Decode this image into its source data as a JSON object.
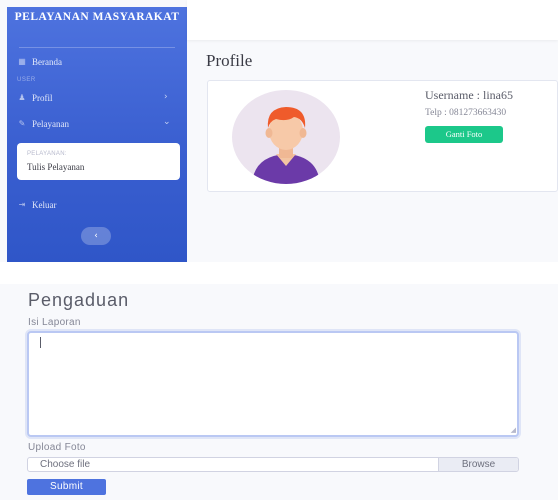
{
  "sidebar": {
    "brand": "PELAYANAN MASYARAKAT",
    "dashboard_label": "Beranda",
    "section_user": "USER",
    "profile_label": "Profil",
    "service_label": "Pelayanan",
    "submenu_header": "PELAYANAN:",
    "submenu_item": "Tulis Pelayanan",
    "logout_label": "Keluar",
    "toggle_glyph": "‹",
    "icons": [
      "dashboard-icon",
      "user-icon",
      "wrench-icon",
      "logout-icon",
      "chevron-right-icon",
      "chevron-down-icon"
    ]
  },
  "profile": {
    "title": "Profile",
    "username": "Username : lina65",
    "telp": "Telp : 081273663430",
    "button_label": "Ganti Foto"
  },
  "form": {
    "title": "Pengaduan",
    "report_label": "Isi Laporan",
    "upload_label": "Upload Foto",
    "file_placeholder": "Choose file",
    "browse_label": "Browse",
    "submit_label": "Submit"
  },
  "colors": {
    "sidebar_primary": "#4e73df",
    "success": "#1cc88a",
    "primary": "#4e73df"
  }
}
